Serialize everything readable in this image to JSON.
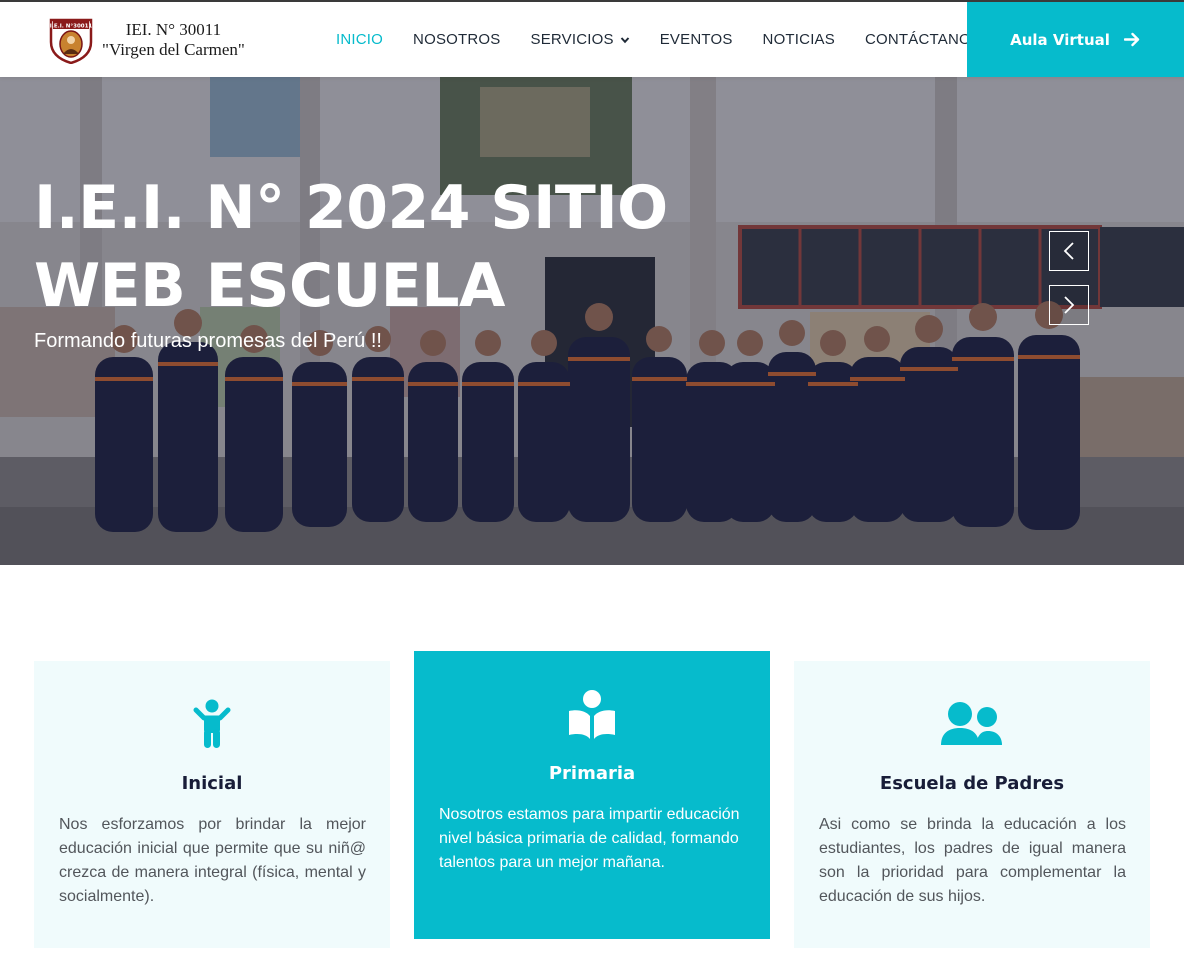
{
  "brand": {
    "line1": "IEI. N° 30011",
    "line2": "\"Virgen del Carmen\"",
    "crest_text": "I.E.I. N°30011"
  },
  "nav": {
    "items": [
      {
        "label": "INICIO",
        "active": true
      },
      {
        "label": "NOSOTROS",
        "active": false
      },
      {
        "label": "SERVICIOS",
        "active": false,
        "dropdown": true
      },
      {
        "label": "EVENTOS",
        "active": false
      },
      {
        "label": "NOTICIAS",
        "active": false
      },
      {
        "label": "CONTÁCTANOS",
        "active": false
      }
    ],
    "cta_label": "Aula Virtual",
    "cta_icon": "arrow-right-icon"
  },
  "hero": {
    "title": "I.E.I. N° 2024 SITIO WEB ESCUELA",
    "subtitle": "Formando futuras promesas del Perú !!",
    "prev_icon": "chevron-left-icon",
    "next_icon": "chevron-right-icon"
  },
  "services": [
    {
      "title": "Inicial",
      "text": "Nos esforzamos por brindar la mejor educación inicial que permite que su niñ@ crezca de manera integral (física, mental y socialmente).",
      "icon": "child-icon"
    },
    {
      "title": "Primaria",
      "text": "Nosotros estamos para impartir educación nivel básica primaria de calidad, formando talentos para un mejor mañana.",
      "icon": "book-reader-icon"
    },
    {
      "title": "Escuela de Padres",
      "text": "Asi como se brinda la educación a los estudiantes, los padres de igual manera son la prioridad para complementar la educación de sus hijos.",
      "icon": "users-icon"
    }
  ],
  "colors": {
    "accent": "#06bbcc",
    "dark": "#181d38",
    "card_bg": "#f0fbfc"
  }
}
